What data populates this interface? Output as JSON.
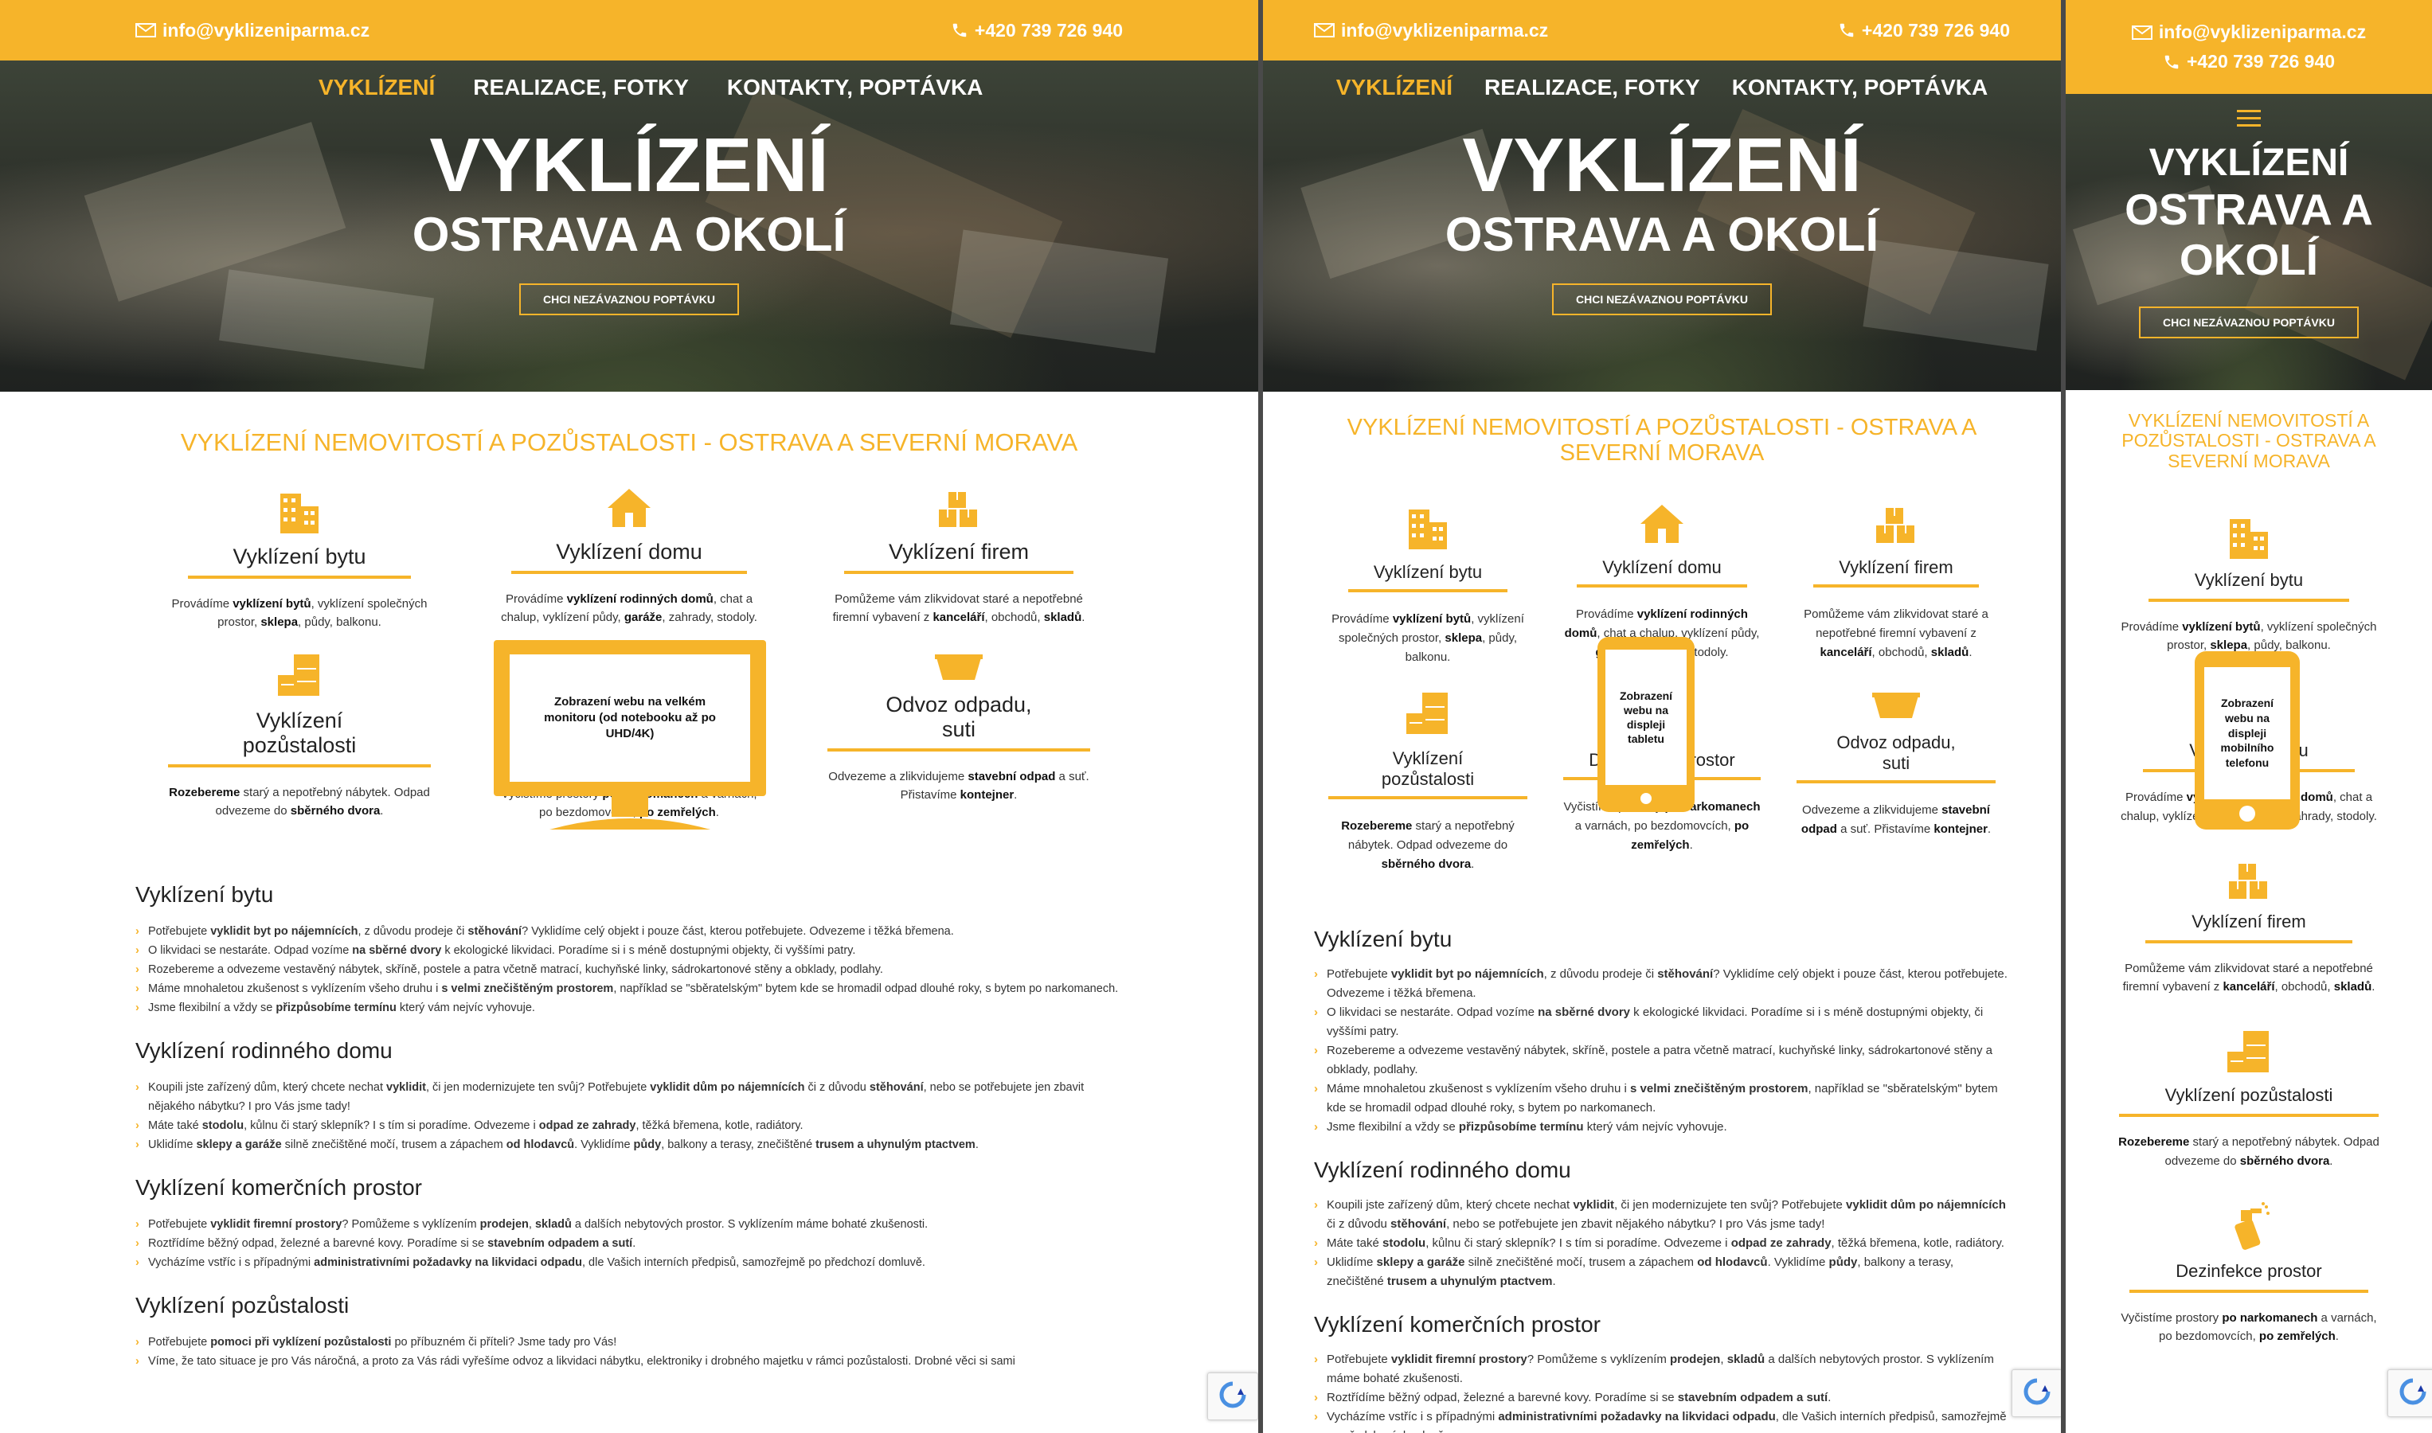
{
  "colors": {
    "accent": "#f6b42a",
    "text": "#222222",
    "background": "#ffffff"
  },
  "topbar": {
    "email": "info@vyklizeniparma.cz",
    "phone": "+420 739 726 940"
  },
  "nav": {
    "items": [
      "VYKLÍZENÍ",
      "REALIZACE, FOTKY",
      "KONTAKTY, POPTÁVKA"
    ]
  },
  "hero": {
    "title": "VYKLÍZENÍ",
    "subtitle": "OSTRAVA A OKOLÍ",
    "cta": "CHCI NEZÁVAZNOU POPTÁVKU"
  },
  "section_title": "VYKLÍZENÍ NEMOVITOSTÍ A POZŮSTALOSTI - OSTRAVA A SEVERNÍ MORAVA",
  "services": [
    {
      "name": "Vyklízení bytu",
      "icon": "building-icon",
      "desc": [
        [
          "Provádíme ",
          0
        ],
        [
          "vyklízení bytů",
          1
        ],
        [
          ", vyklízení společných prostor, ",
          0
        ],
        [
          "sklepa",
          1
        ],
        [
          ", půdy, balkonu.",
          0
        ]
      ]
    },
    {
      "name": "Vyklízení domu",
      "icon": "house-icon",
      "desc": [
        [
          "Provádíme ",
          0
        ],
        [
          "vyklízení rodinných domů",
          1
        ],
        [
          ", chat a chalup, vyklízení půdy, ",
          0
        ],
        [
          "garáže",
          1
        ],
        [
          ", zahrady, stodoly.",
          0
        ]
      ]
    },
    {
      "name": "Vyklízení firem",
      "icon": "boxes-icon",
      "desc": [
        [
          "Pomůžeme vám zlikvidovat staré a nepotřebné firemní vybavení z ",
          0
        ],
        [
          "kanceláří",
          1
        ],
        [
          ", obchodů, ",
          0
        ],
        [
          "skladů",
          1
        ],
        [
          ".",
          0
        ]
      ]
    },
    {
      "name": "Vyklízení pozůstalosti",
      "icon": "furniture-icon",
      "desc": [
        [
          "Rozebereme",
          1
        ],
        [
          " starý a nepotřebný nábytek. Odpad odvezeme do ",
          0
        ],
        [
          "sběrného dvora",
          1
        ],
        [
          ".",
          0
        ]
      ]
    },
    {
      "name": "Dezinfekce prostor",
      "icon": "spray-icon",
      "desc": [
        [
          "Vyčistíme prostory ",
          0
        ],
        [
          "po narkomanech",
          1
        ],
        [
          " a varnách, po bezdomovcích, ",
          0
        ],
        [
          "po zemřelých",
          1
        ],
        [
          ".",
          0
        ]
      ]
    },
    {
      "name": "Odvoz odpadu, suti",
      "icon": "bin-icon",
      "desc": [
        [
          "Odvezeme a zlikvidujeme ",
          0
        ],
        [
          "stavební odpad",
          1
        ],
        [
          " a suť. Přistavíme ",
          0
        ],
        [
          "kontejner",
          1
        ],
        [
          ".",
          0
        ]
      ]
    }
  ],
  "overlays": {
    "monitor": "Zobrazení webu na velkém monitoru (od notebooku až po UHD/4K)",
    "tablet": "Zobrazení webu na displeji tabletu",
    "phone": "Zobrazení webu na displeji mobilního telefonu"
  },
  "content": [
    {
      "title": "Vyklízení bytu",
      "items": [
        [
          [
            "Potřebujete ",
            0
          ],
          [
            "vyklidit byt po nájemnících",
            1
          ],
          [
            ", z důvodu prodeje či ",
            0
          ],
          [
            "stěhování",
            1
          ],
          [
            "? Vyklidíme celý objekt i pouze část, kterou potřebujete. Odvezeme i těžká břemena.",
            0
          ]
        ],
        [
          [
            "O likvidaci se nestaráte. Odpad vozíme ",
            0
          ],
          [
            "na sběrné dvory",
            1
          ],
          [
            " k ekologické likvidaci. Poradíme si i s méně dostupnými objekty, či vyššími patry.",
            0
          ]
        ],
        [
          [
            "Rozebereme a odvezeme vestavěný nábytek, skříně, postele a patra včetně matrací, kuchyňské linky, sádrokartonové stěny a obklady, podlahy.",
            0
          ]
        ],
        [
          [
            "Máme mnohaletou zkušenost s vyklízením všeho druhu i ",
            0
          ],
          [
            "s velmi znečištěným prostorem",
            1
          ],
          [
            ", například se \"sběratelským\" bytem kde se hromadil odpad dlouhé roky, s bytem po narkomanech.",
            0
          ]
        ],
        [
          [
            "Jsme flexibilní a vždy se ",
            0
          ],
          [
            "přizpůsobíme termínu",
            1
          ],
          [
            " který vám nejvíc vyhovuje.",
            0
          ]
        ]
      ]
    },
    {
      "title": "Vyklízení rodinného domu",
      "items": [
        [
          [
            "Koupili jste zařízený dům, který chcete nechat ",
            0
          ],
          [
            "vyklidit",
            1
          ],
          [
            ", či jen modernizujete ten svůj? Potřebujete ",
            0
          ],
          [
            "vyklidit dům po nájemnících",
            1
          ],
          [
            " či z důvodu ",
            0
          ],
          [
            "stěhování",
            1
          ],
          [
            ", nebo se potřebujete jen zbavit nějakého nábytku? I pro Vás jsme tady!",
            0
          ]
        ],
        [
          [
            "Máte také ",
            0
          ],
          [
            "stodolu",
            1
          ],
          [
            ", kůlnu či starý sklepník? I s tím si poradíme. Odvezeme i ",
            0
          ],
          [
            "odpad ze zahrady",
            1
          ],
          [
            ", těžká břemena, kotle, radiátory.",
            0
          ]
        ],
        [
          [
            "Uklidíme ",
            0
          ],
          [
            "sklepy a garáže",
            1
          ],
          [
            " silně znečištěné močí, trusem a zápachem ",
            0
          ],
          [
            "od hlodavců",
            1
          ],
          [
            ". Vyklidíme ",
            0
          ],
          [
            "půdy",
            1
          ],
          [
            ", balkony a terasy, znečištěné ",
            0
          ],
          [
            "trusem a uhynulým ptactvem",
            1
          ],
          [
            ".",
            0
          ]
        ]
      ]
    },
    {
      "title": "Vyklízení komerčních prostor",
      "items": [
        [
          [
            "Potřebujete ",
            0
          ],
          [
            "vyklidit firemní prostory",
            1
          ],
          [
            "? Pomůžeme s vyklízením ",
            0
          ],
          [
            "prodejen",
            1
          ],
          [
            ", ",
            0
          ],
          [
            "skladů",
            1
          ],
          [
            " a dalších nebytových prostor. S vyklízením máme bohaté zkušenosti.",
            0
          ]
        ],
        [
          [
            "Roztřídíme běžný odpad, železné a barevné kovy. Poradíme si se ",
            0
          ],
          [
            "stavebním odpadem a sutí",
            1
          ],
          [
            ".",
            0
          ]
        ],
        [
          [
            "Vycházíme vstříc i s případnými ",
            0
          ],
          [
            "administrativními požadavky na likvidaci odpadu",
            1
          ],
          [
            ", dle Vašich interních předpisů, samozřejmě po předchozí domluvě.",
            0
          ]
        ]
      ]
    },
    {
      "title": "Vyklízení pozůstalosti",
      "items": [
        [
          [
            "Potřebujete ",
            0
          ],
          [
            "pomoci při vyklízení pozůstalosti",
            1
          ],
          [
            " po příbuzném či příteli? Jsme tady pro Vás!",
            0
          ]
        ],
        [
          [
            "Víme, že tato situace je pro Vás náročná, a proto za Vás rádi vyřešíme odvoz a likvidaci nábytku, elektroniky i drobného majetku v rámci pozůstalosti. Drobné věci si sami",
            0
          ]
        ]
      ]
    }
  ]
}
